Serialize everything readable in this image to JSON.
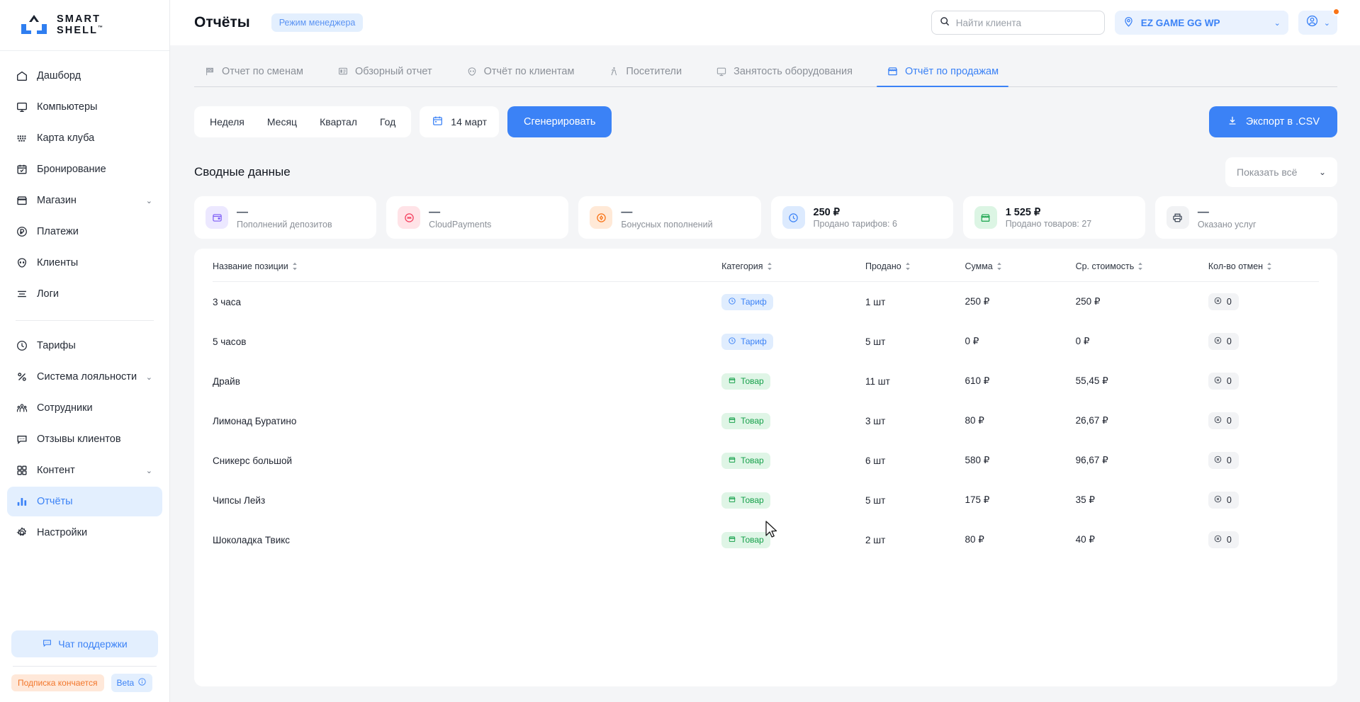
{
  "brand": {
    "line1": "SMART",
    "line2": "SHELL",
    "tm": "™"
  },
  "sidebar": {
    "group1": [
      {
        "label": "Дашборд",
        "icon": "home-icon"
      },
      {
        "label": "Компьютеры",
        "icon": "monitor-icon"
      },
      {
        "label": "Карта клуба",
        "icon": "grid-dots-icon"
      },
      {
        "label": "Бронирование",
        "icon": "calendar-check-icon"
      },
      {
        "label": "Магазин",
        "icon": "shop-icon",
        "chevron": "⌄"
      },
      {
        "label": "Платежи",
        "icon": "ruble-circle-icon"
      },
      {
        "label": "Клиенты",
        "icon": "alien-icon"
      },
      {
        "label": "Логи",
        "icon": "lines-icon"
      }
    ],
    "group2": [
      {
        "label": "Тарифы",
        "icon": "clock-icon"
      },
      {
        "label": "Система лояльности",
        "icon": "percent-icon",
        "chevron": "⌄"
      },
      {
        "label": "Сотрудники",
        "icon": "people-icon"
      },
      {
        "label": "Отзывы клиентов",
        "icon": "chat-icon"
      },
      {
        "label": "Контент",
        "icon": "squares-icon",
        "chevron": "⌄"
      },
      {
        "label": "Отчёты",
        "icon": "bar-chart-icon",
        "active": true
      },
      {
        "label": "Настройки",
        "icon": "gear-icon"
      }
    ],
    "support_label": "Чат поддержки",
    "subscription_badge": "Подписка кончается",
    "beta_badge": "Beta"
  },
  "header": {
    "title": "Отчёты",
    "mode_badge": "Режим менеджера",
    "search_placeholder": "Найти клиента",
    "search_value": "",
    "club": "EZ GAME GG WP",
    "chevron": "⌄"
  },
  "tabs": [
    {
      "label": "Отчет по сменам",
      "icon": "flag-icon",
      "active": false
    },
    {
      "label": "Обзорный отчет",
      "icon": "presentation-icon",
      "active": false
    },
    {
      "label": "Отчёт по клиентам",
      "icon": "alien-icon",
      "active": false
    },
    {
      "label": "Посетители",
      "icon": "walking-icon",
      "active": false
    },
    {
      "label": "Занятость оборудования",
      "icon": "monitor-icon",
      "active": false
    },
    {
      "label": "Отчёт по продажам",
      "icon": "shop-icon",
      "active": true
    }
  ],
  "toolbar": {
    "periods": [
      "Неделя",
      "Месяц",
      "Квартал",
      "Год"
    ],
    "date": "14 март",
    "generate_label": "Сгенерировать",
    "export_label": "Экспорт в .CSV"
  },
  "summary": {
    "title": "Сводные данные",
    "show_all": "Показать всё",
    "cards": [
      {
        "value": "—",
        "label": "Пополнений депозитов",
        "icon": "wallet-icon",
        "accent": "#7c5cf5",
        "bg": "#ece8ff",
        "empty": true
      },
      {
        "value": "—",
        "label": "CloudPayments",
        "icon": "cloudpayments-icon",
        "accent": "#f43f5e",
        "bg": "#ffe3e7",
        "empty": true
      },
      {
        "value": "—",
        "label": "Бонусных пополнений",
        "icon": "bonus-icon",
        "accent": "#f97316",
        "bg": "#ffe9d7",
        "empty": true
      },
      {
        "value": "250 ₽",
        "label": "Продано тарифов: 6",
        "icon": "clock-icon",
        "accent": "#3b82f6",
        "bg": "#dceafe",
        "empty": false
      },
      {
        "value": "1 525 ₽",
        "label": "Продано товаров: 27",
        "icon": "shop-icon",
        "accent": "#16a34a",
        "bg": "#dcf5e4",
        "empty": false
      },
      {
        "value": "—",
        "label": "Оказано услуг",
        "icon": "printer-icon",
        "accent": "#374151",
        "bg": "#f1f2f4",
        "empty": true
      }
    ]
  },
  "table": {
    "columns": [
      {
        "label": "Название позиции",
        "key": "name"
      },
      {
        "label": "Категория",
        "key": "category"
      },
      {
        "label": "Продано",
        "key": "sold"
      },
      {
        "label": "Сумма",
        "key": "sum"
      },
      {
        "label": "Ср. стоимость",
        "key": "avg"
      },
      {
        "label": "Кол-во отмен",
        "key": "cancels"
      }
    ],
    "rows": [
      {
        "name": "3 часа",
        "category": "Тариф",
        "cat_type": "tariff",
        "sold": "1 шт",
        "sum": "250 ₽",
        "avg": "250 ₽",
        "cancels": "0"
      },
      {
        "name": "5 часов",
        "category": "Тариф",
        "cat_type": "tariff",
        "sold": "5 шт",
        "sum": "0 ₽",
        "avg": "0 ₽",
        "cancels": "0"
      },
      {
        "name": "Драйв",
        "category": "Товар",
        "cat_type": "goods",
        "sold": "11 шт",
        "sum": "610 ₽",
        "avg": "55,45 ₽",
        "cancels": "0"
      },
      {
        "name": "Лимонад Буратино",
        "category": "Товар",
        "cat_type": "goods",
        "sold": "3 шт",
        "sum": "80 ₽",
        "avg": "26,67 ₽",
        "cancels": "0"
      },
      {
        "name": "Сникерс большой",
        "category": "Товар",
        "cat_type": "goods",
        "sold": "6 шт",
        "sum": "580 ₽",
        "avg": "96,67 ₽",
        "cancels": "0"
      },
      {
        "name": "Чипсы Лейз",
        "category": "Товар",
        "cat_type": "goods",
        "sold": "5 шт",
        "sum": "175 ₽",
        "avg": "35 ₽",
        "cancels": "0"
      },
      {
        "name": "Шоколадка Твикс",
        "category": "Товар",
        "cat_type": "goods",
        "sold": "2 шт",
        "sum": "80 ₽",
        "avg": "40 ₽",
        "cancels": "0"
      }
    ]
  },
  "colors": {
    "accent": "#3b82f6",
    "accent_soft": "#e3effe",
    "page_bg": "#f4f5f7",
    "warn": "#f2762a",
    "green": "#15a04a"
  }
}
